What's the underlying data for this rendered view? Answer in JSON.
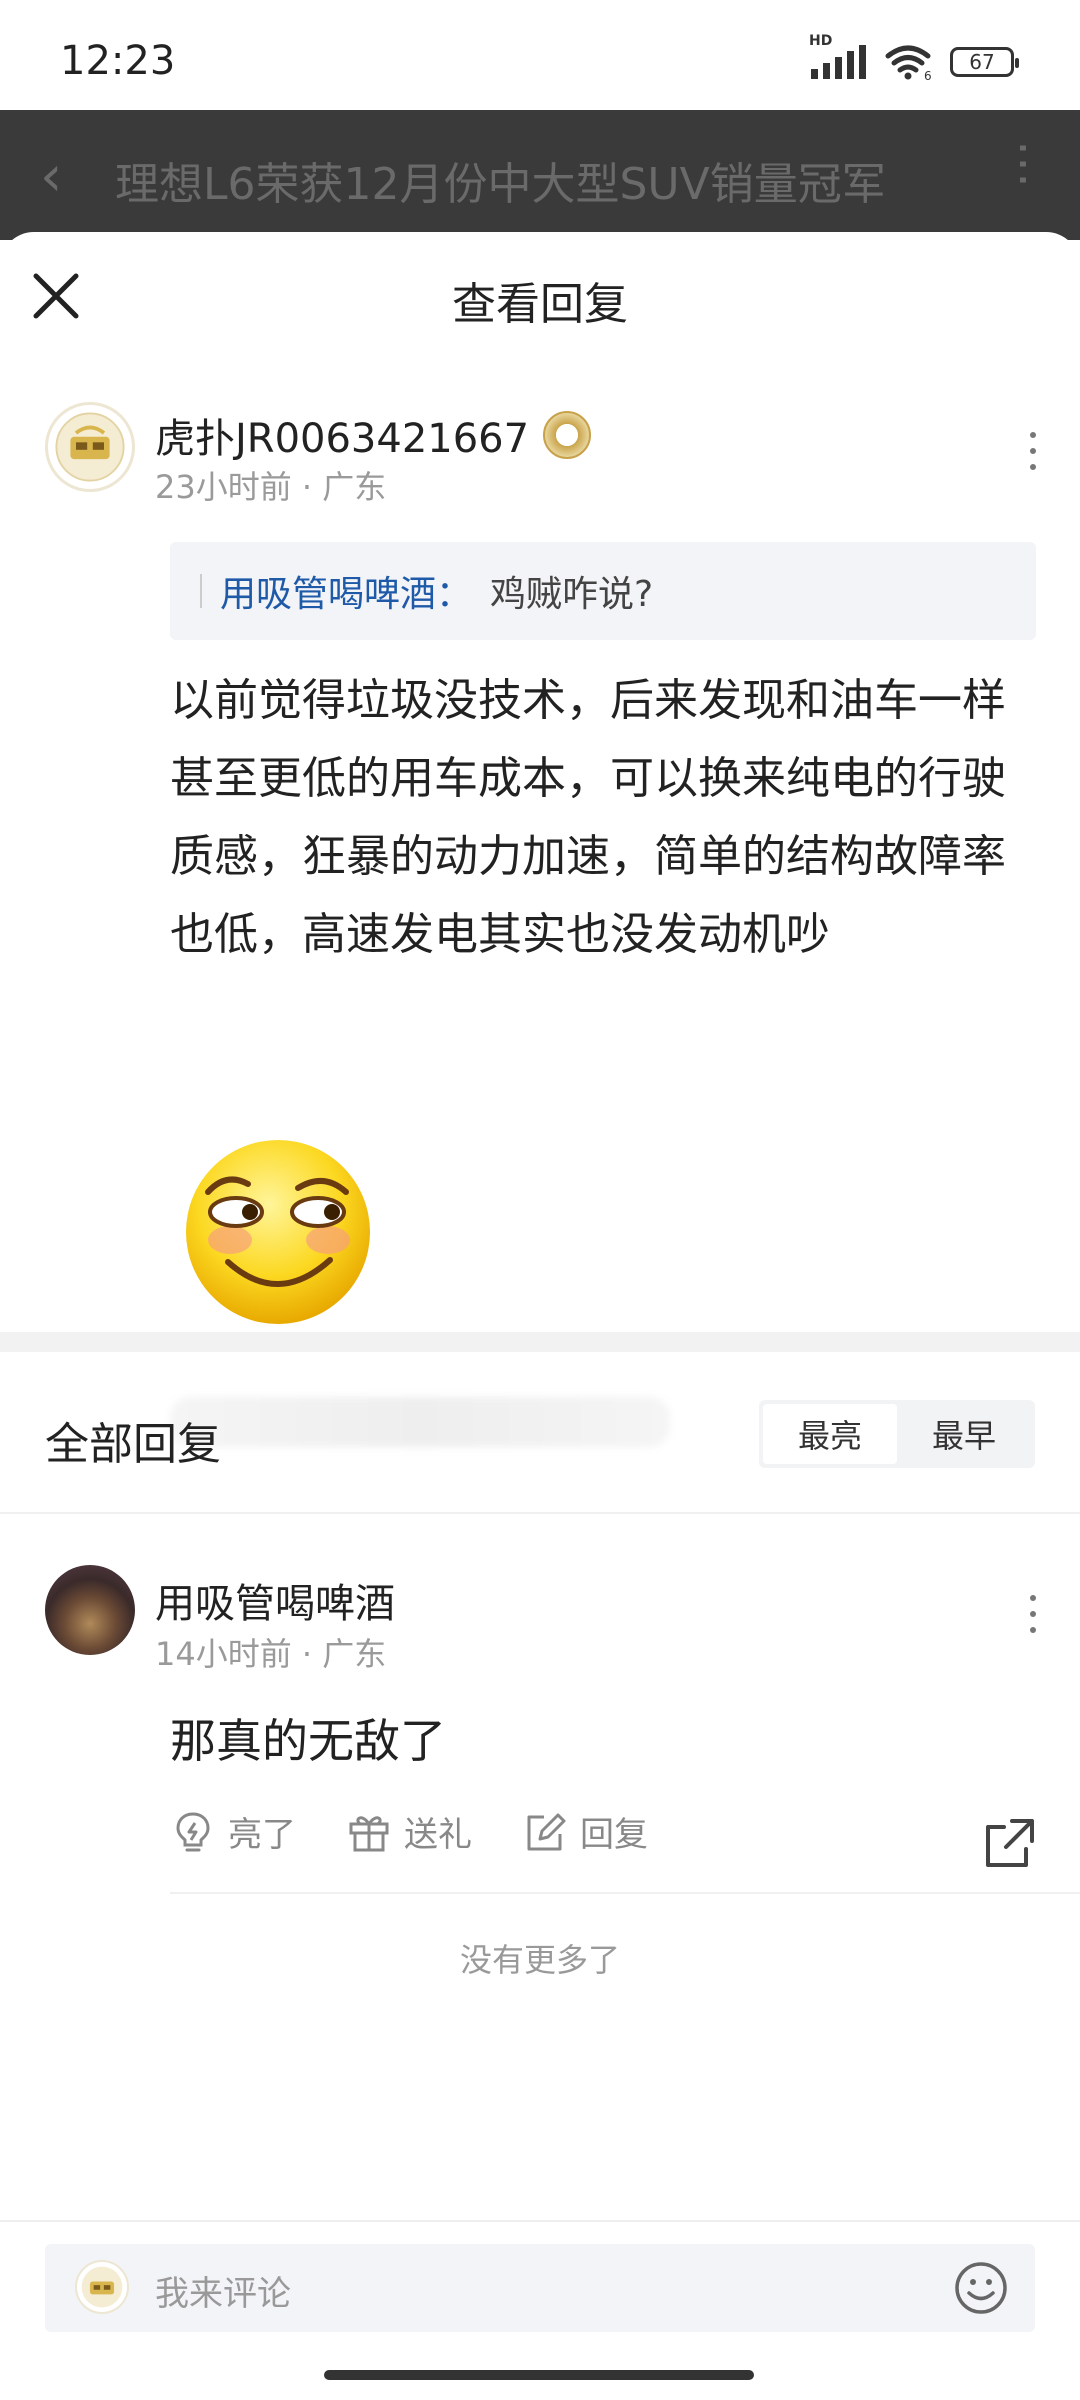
{
  "status_bar": {
    "time": "12:23",
    "network": "HD",
    "wifi_badge": "6",
    "battery": "67"
  },
  "background_page": {
    "title": "理想L6荣获12月份中大型SUV销量冠军"
  },
  "sheet": {
    "title": "查看回复"
  },
  "post": {
    "username": "虎扑JR0063421667",
    "time": "23小时前",
    "location": "广东",
    "quote_name": "用吸管喝啤酒：",
    "quote_text": "鸡贼咋说?",
    "content": "以前觉得垃圾没技术，后来发现和油车一样甚至更低的用车成本，可以换来纯电的行驶质感，狂暴的动力加速，简单的结构故障率也低，高速发电其实也没发动机吵"
  },
  "replies_section": {
    "title": "全部回复",
    "sort_options": [
      "最亮",
      "最早"
    ],
    "active_sort": "最亮"
  },
  "replies": [
    {
      "username": "用吸管喝啤酒",
      "time": "14小时前",
      "location": "广东",
      "text": "那真的无敌了",
      "actions": {
        "light": "亮了",
        "gift": "送礼",
        "reply": "回复"
      }
    }
  ],
  "no_more": "没有更多了",
  "comment_input": {
    "placeholder": "我来评论"
  },
  "colors": {
    "quote_name": "#1f5aa8",
    "overlay_bar": "#3a3a3a"
  }
}
